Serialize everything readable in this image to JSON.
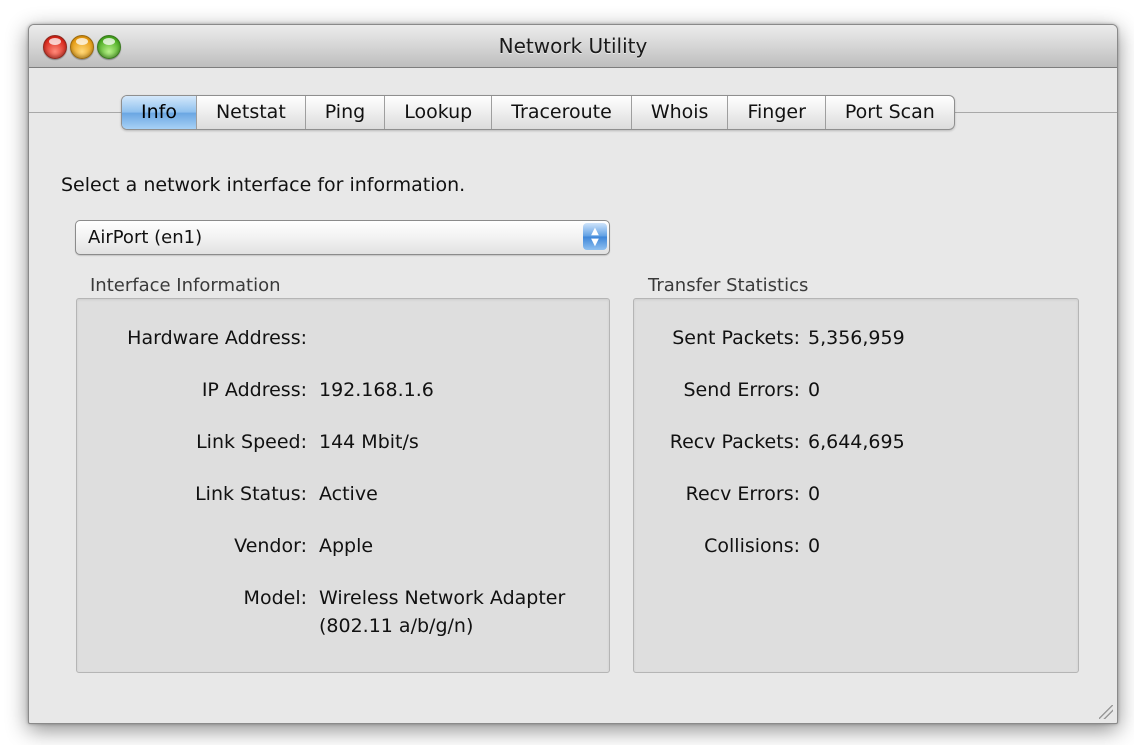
{
  "window": {
    "title": "Network Utility"
  },
  "tabs": [
    "Info",
    "Netstat",
    "Ping",
    "Lookup",
    "Traceroute",
    "Whois",
    "Finger",
    "Port Scan"
  ],
  "active_tab": "Info",
  "prompt": "Select a network interface for information.",
  "interface_select": {
    "value": "AirPort (en1)"
  },
  "interface_info": {
    "title": "Interface Information",
    "hardware_address_label": "Hardware Address:",
    "hardware_address_value": "",
    "ip_label": "IP Address:",
    "ip_value": "192.168.1.6",
    "speed_label": "Link Speed:",
    "speed_value": "144 Mbit/s",
    "status_label": "Link Status:",
    "status_value": "Active",
    "vendor_label": "Vendor:",
    "vendor_value": "Apple",
    "model_label": "Model:",
    "model_value_line1": "Wireless Network Adapter",
    "model_value_line2": "(802.11 a/b/g/n)"
  },
  "transfer_stats": {
    "title": "Transfer Statistics",
    "sent_label": "Sent Packets:",
    "sent_value": "5,356,959",
    "send_errors_label": "Send Errors:",
    "send_errors_value": "0",
    "recv_label": "Recv Packets:",
    "recv_value": "6,644,695",
    "recv_errors_label": "Recv Errors:",
    "recv_errors_value": "0",
    "collisions_label": "Collisions:",
    "collisions_value": "0"
  }
}
